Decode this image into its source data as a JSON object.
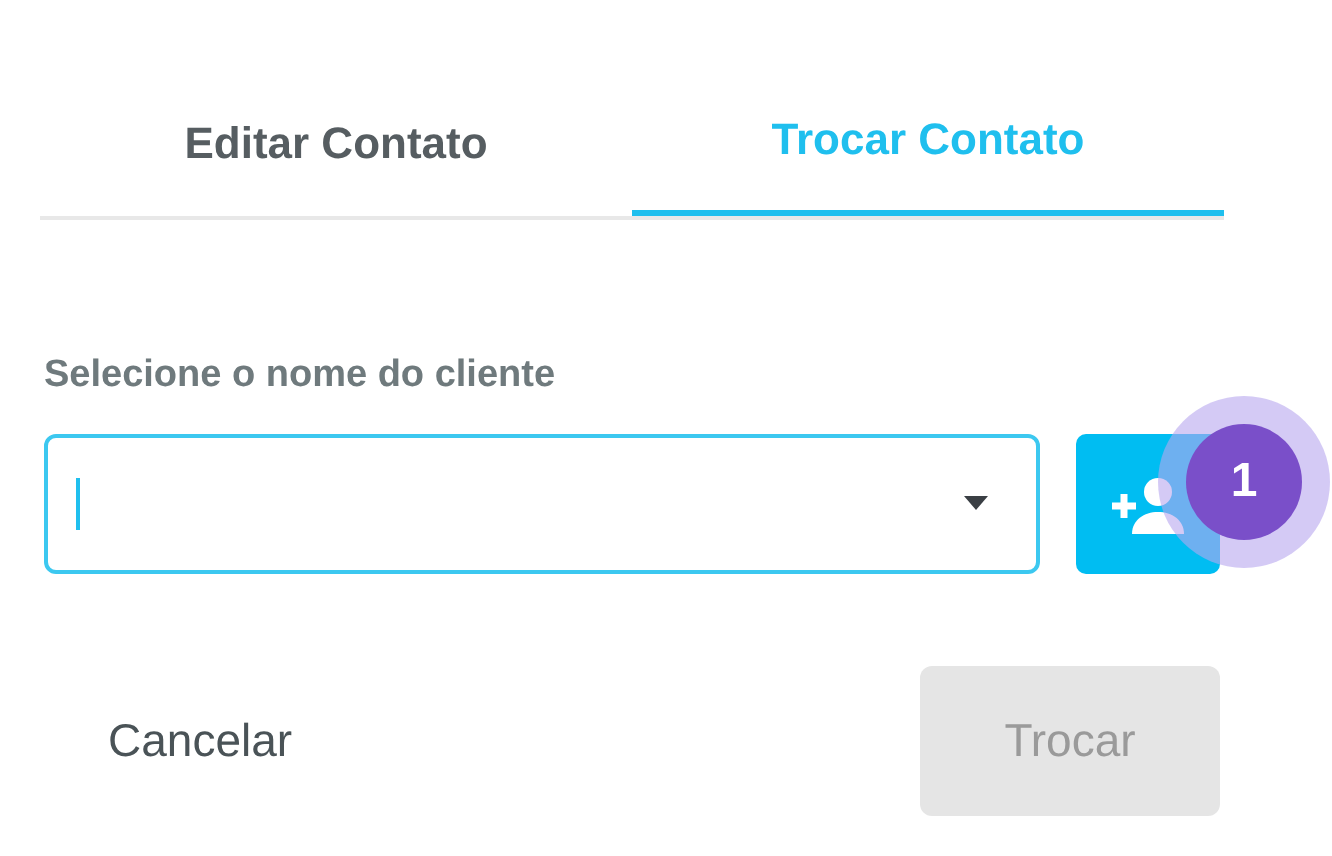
{
  "tabs": [
    {
      "label": "Editar Contato",
      "selected": false
    },
    {
      "label": "Trocar Contato",
      "selected": true
    }
  ],
  "client_field": {
    "label": "Selecione o nome do cliente",
    "focused": true
  },
  "step_badge": "1",
  "buttons": [
    {
      "label": "Cancelar",
      "kind": "text",
      "disabled": false
    },
    {
      "label": "Trocar",
      "kind": "filled",
      "disabled": true
    }
  ]
}
